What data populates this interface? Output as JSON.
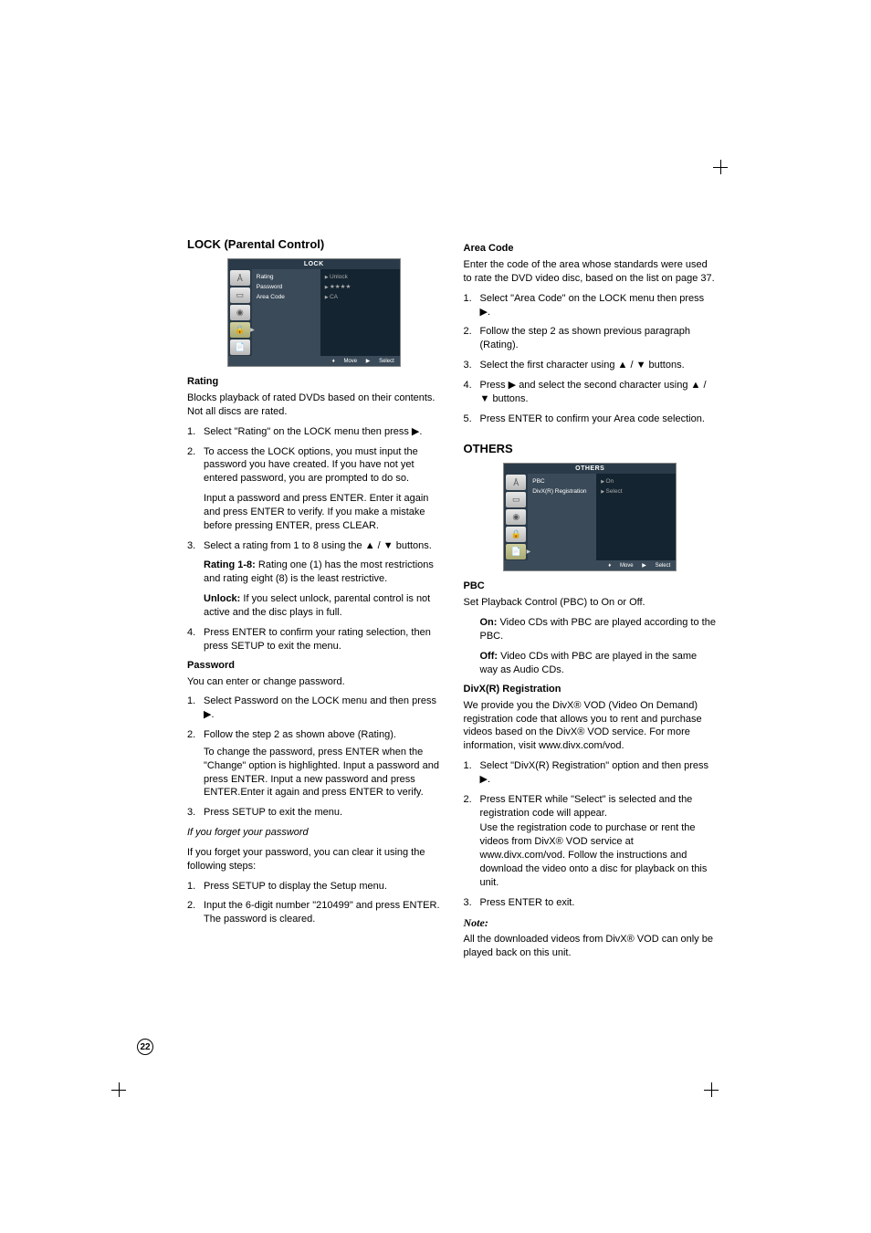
{
  "page_number": "22",
  "left": {
    "h2": "LOCK (Parental Control)",
    "menu": {
      "title": "LOCK",
      "rows": [
        {
          "label": "Rating",
          "value": "Unlock"
        },
        {
          "label": "Password",
          "value": "★★★★"
        },
        {
          "label": "Area Code",
          "value": "CA"
        }
      ],
      "footer_move": "Move",
      "footer_select": "Select"
    },
    "rating": {
      "h3": "Rating",
      "intro": "Blocks playback of rated DVDs based on their contents. Not all discs are rated.",
      "li1": "Select \"Rating\" on the LOCK menu then press ▶.",
      "li2": "To access the LOCK options, you must input the password you have created. If you have not yet entered password, you are prompted to do so.",
      "li2b": "Input a password and press ENTER. Enter it again and press ENTER to verify. If you make a mistake before pressing ENTER, press CLEAR.",
      "li3": "Select a rating from 1 to 8 using the ▲ / ▼ buttons.",
      "li3b_label": "Rating 1-8:",
      "li3b": " Rating one (1) has the most restrictions and rating eight (8) is the least restrictive.",
      "li3c_label": "Unlock:",
      "li3c": " If you select unlock, parental control is not active and the disc plays in full.",
      "li4": "Press ENTER to confirm your rating selection, then press SETUP to exit the menu."
    },
    "password": {
      "h3": "Password",
      "intro": "You can enter or change password.",
      "li1": "Select Password on the LOCK menu and then press ▶.",
      "li2": "Follow the step 2 as shown above (Rating).",
      "li2b": "To change the password, press ENTER when the \"Change\" option is highlighted. Input a password and press ENTER. Input a new password and press ENTER.Enter it again and press ENTER to verify.",
      "li3": "Press SETUP to exit the menu.",
      "forgot_h": "If you forget your password",
      "forgot_p": "If you forget your password, you can clear it using the following steps:",
      "f1": "Press SETUP to display the Setup menu.",
      "f2": "Input the 6-digit number \"210499\" and press ENTER. The password is cleared."
    }
  },
  "right": {
    "area": {
      "h3": "Area Code",
      "intro": "Enter the code of the area whose standards were used to rate the DVD video disc, based on the list on page 37.",
      "li1": "Select \"Area Code\" on the LOCK menu then press ▶.",
      "li2": "Follow the step 2 as shown previous paragraph (Rating).",
      "li3": "Select the first character using ▲ / ▼ buttons.",
      "li4": "Press ▶ and select the second character using ▲ / ▼ buttons.",
      "li5": "Press ENTER to confirm your Area code selection."
    },
    "others_h2": "OTHERS",
    "menu": {
      "title": "OTHERS",
      "rows": [
        {
          "label": "PBC",
          "value": "On"
        },
        {
          "label": "DivX(R) Registration",
          "value": "Select"
        }
      ],
      "footer_move": "Move",
      "footer_select": "Select"
    },
    "pbc": {
      "h3": "PBC",
      "intro": "Set Playback Control (PBC) to On or Off.",
      "on_label": "On:",
      "on": " Video CDs with PBC are played according to the PBC.",
      "off_label": "Off:",
      "off": " Video CDs with PBC are played in the same way as Audio CDs."
    },
    "divx": {
      "h3": "DivX(R) Registration",
      "intro": "We provide you the DivX® VOD (Video On Demand) registration code that allows you to rent and purchase videos based on the DivX® VOD service. For more information, visit www.divx.com/vod.",
      "li1": "Select \"DivX(R) Registration\" option and then press ▶.",
      "li2": "Press ENTER while \"Select\" is selected and the registration code will appear.",
      "li2b": "Use the registration code to purchase or rent the videos from DivX® VOD service at www.divx.com/vod. Follow the instructions and download the video onto a disc for playback on this unit.",
      "li3": "Press ENTER to exit.",
      "note_h": "Note:",
      "note": "All the downloaded videos from DivX® VOD can only be played back on this unit."
    }
  }
}
